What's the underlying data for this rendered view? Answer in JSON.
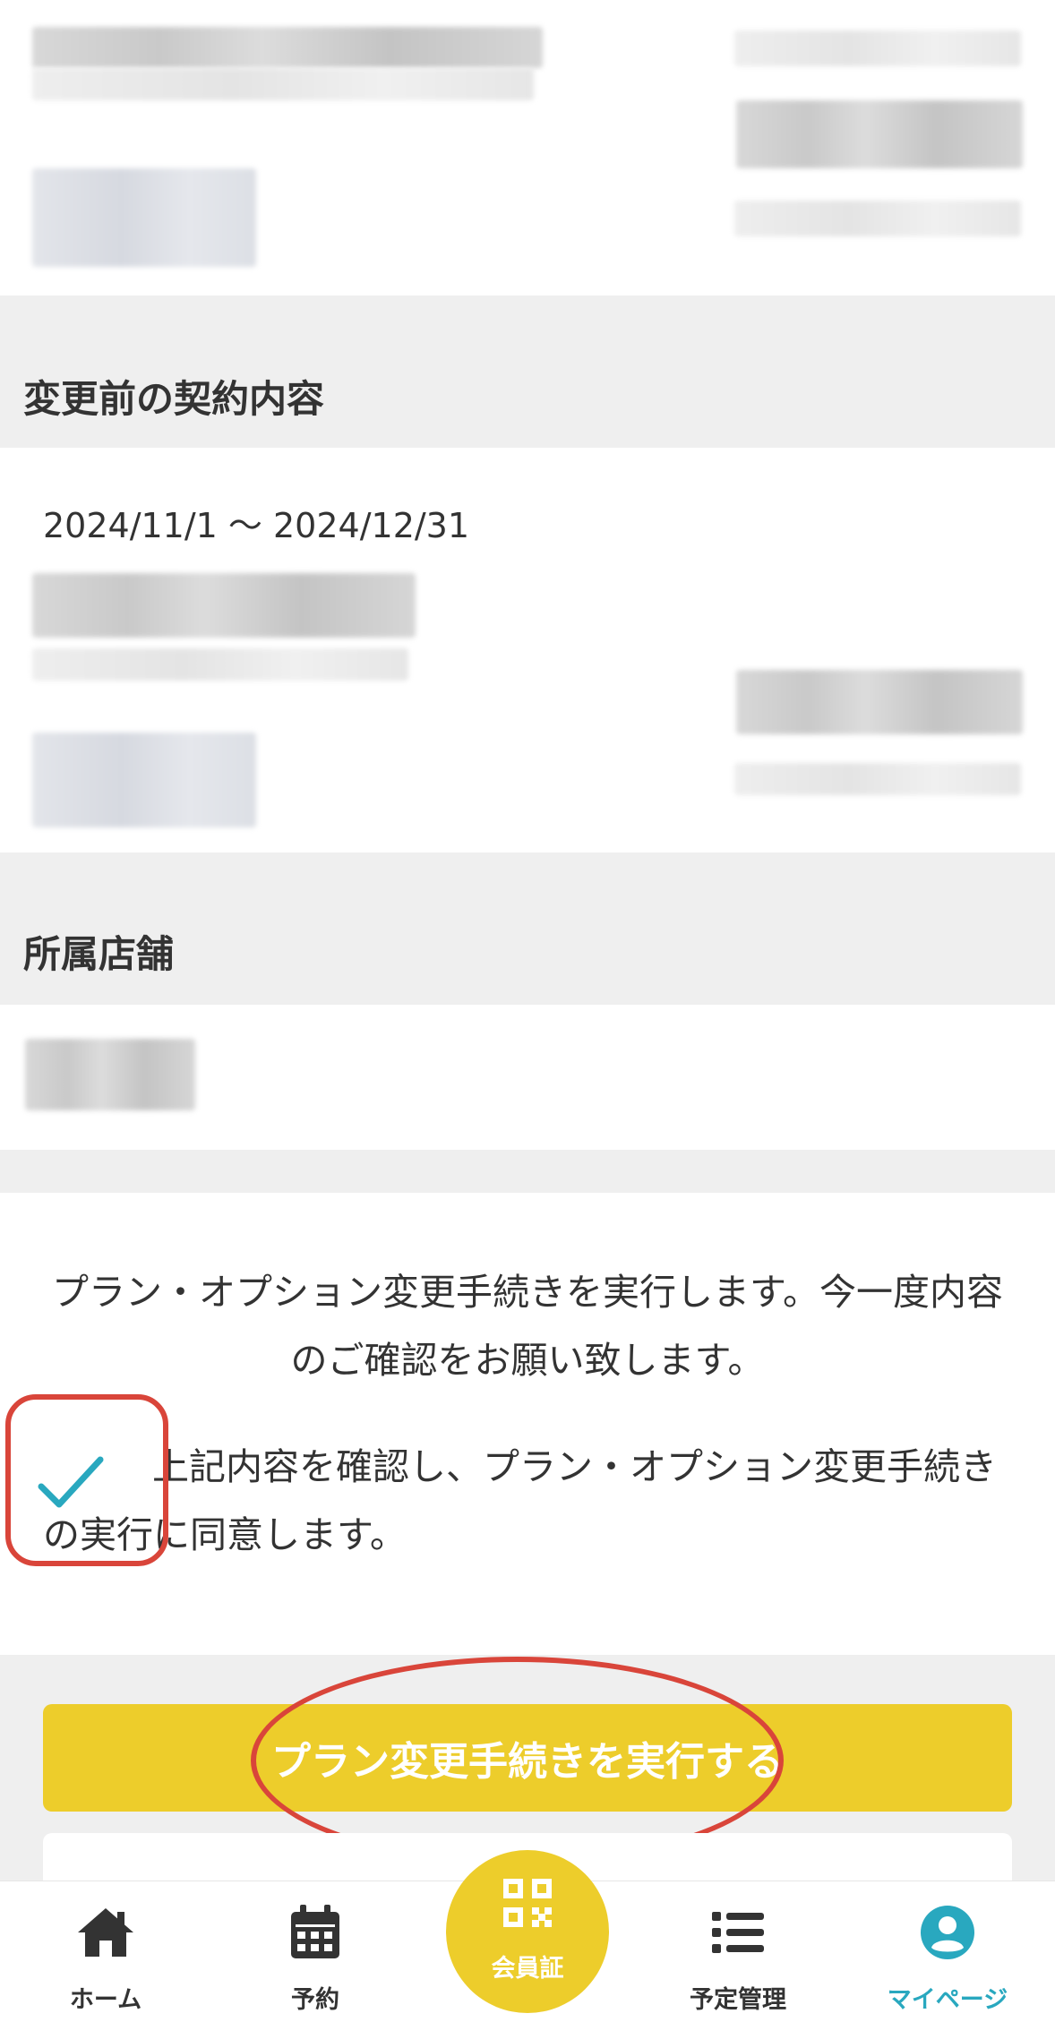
{
  "sections": {
    "before_contract": {
      "title": "変更前の契約内容",
      "period": "2024/11/1 〜 2024/12/31"
    },
    "store": {
      "title": "所属店舗"
    }
  },
  "confirmation": {
    "message": "プラン・オプション変更手続きを実行します。今一度内容のご確認をお願い致します。",
    "agree_label": "上記内容を確認し、プラン・オプション変更手続きの実行に同意します。",
    "agree_checked": true
  },
  "actions": {
    "submit_label": "プラン変更手続きを実行する"
  },
  "tabbar": {
    "home": "ホーム",
    "reserve": "予約",
    "member_card": "会員証",
    "schedule": "予定管理",
    "mypage": "マイページ",
    "active": "mypage"
  },
  "colors": {
    "accent_yellow": "#edcd2b",
    "active_tab": "#29a8bf",
    "annotation_red": "#d9453a",
    "section_band": "#efefef"
  }
}
